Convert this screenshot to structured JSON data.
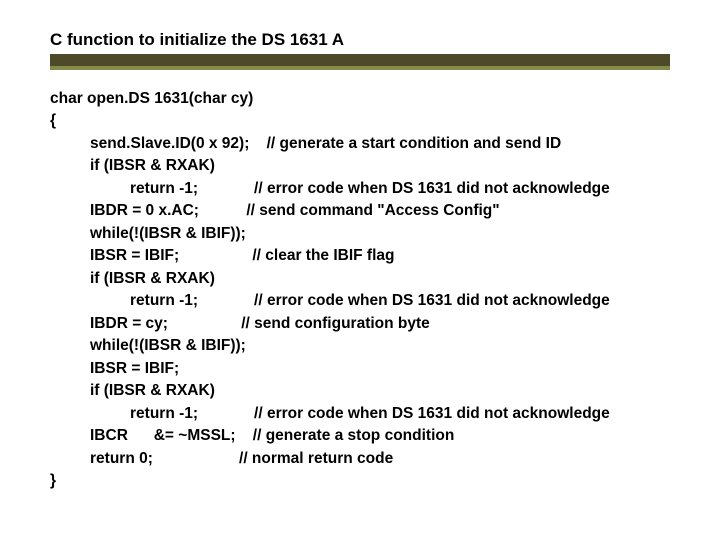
{
  "title": "C function to initialize the DS 1631 A",
  "code": {
    "sig": "char open.DS 1631(char cy)",
    "open": "{",
    "l1a": "send.Slave.ID(0 x 92);",
    "l1c": "// generate a start condition and send ID",
    "l2": "if (IBSR & RXAK)",
    "l3a": "return -1;",
    "l3c": "// error code when DS 1631 did not acknowledge",
    "l4a": "IBDR = 0 x.AC;",
    "l4c": "// send command \"Access Config\"",
    "l5": "while(!(IBSR & IBIF));",
    "l6a": "IBSR = IBIF;",
    "l6c": "// clear the IBIF flag",
    "l7": "if (IBSR & RXAK)",
    "l8a": "return -1;",
    "l8c": "// error code when DS 1631 did not acknowledge",
    "l9a": "IBDR = cy;",
    "l9c": "// send configuration byte",
    "l10": "while(!(IBSR & IBIF));",
    "l11": "IBSR = IBIF;",
    "l12": "if (IBSR & RXAK)",
    "l13a": "return -1;",
    "l13c": "// error code when DS 1631 did not acknowledge",
    "l14a": "IBCR",
    "l14b": "&= ~MSSL;",
    "l14c": "// generate a stop condition",
    "l15a": "return 0;",
    "l15c": "// normal return code",
    "close": "}"
  }
}
